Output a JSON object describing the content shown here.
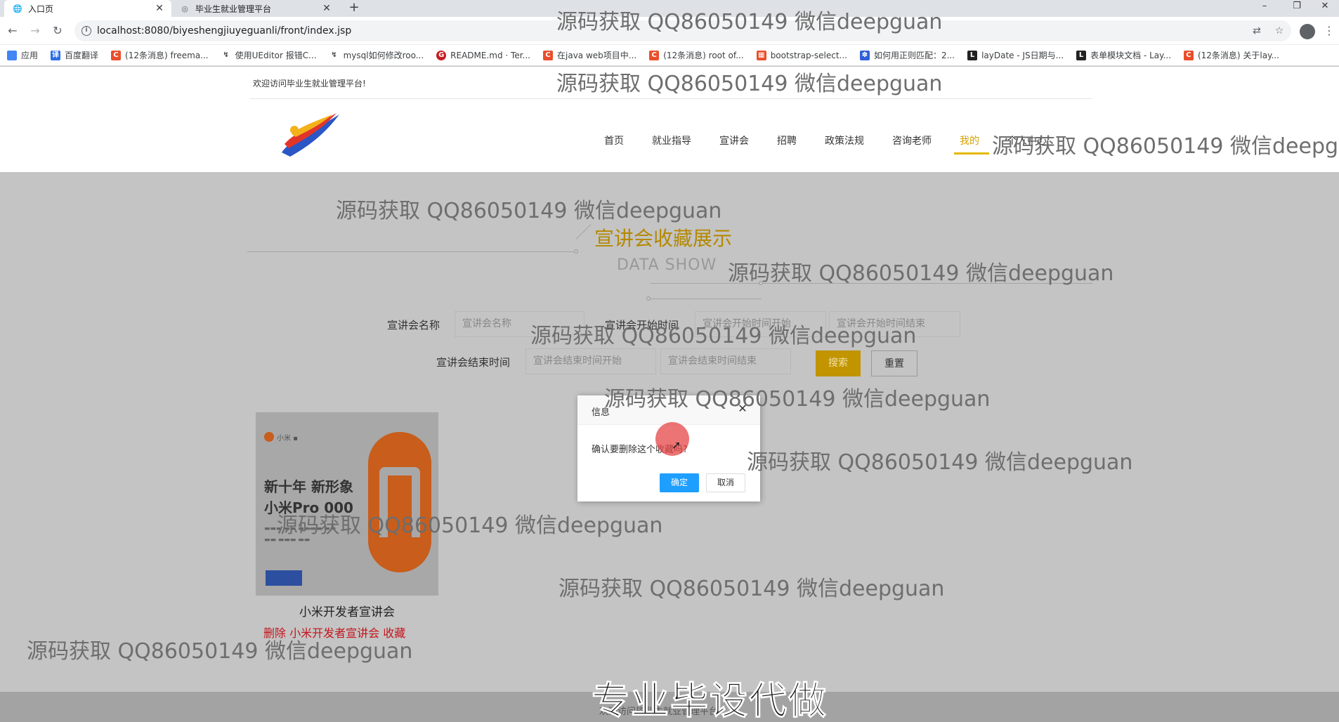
{
  "browser": {
    "tabs": [
      {
        "title": "入口页",
        "active": true
      },
      {
        "title": "毕业生就业管理平台",
        "active": false
      }
    ],
    "new_tab": "+",
    "window_controls": [
      "–",
      "❐",
      "✕"
    ],
    "url": "localhost:8080/biyeshengjiuyeguanli/front/index.jsp",
    "bookmarks": [
      {
        "label": "应用",
        "icon_color": "#4285f4"
      },
      {
        "label": "百度翻译",
        "icon_color": "#2b6de6"
      },
      {
        "label": "(12条消息) freema...",
        "icon_color": "#e94e2b"
      },
      {
        "label": "使用UEditor 报错C...",
        "icon_color": "#444444"
      },
      {
        "label": "mysql如何修改roo...",
        "icon_color": "#444444"
      },
      {
        "label": "README.md · Ter...",
        "icon_color": "#c71d23"
      },
      {
        "label": "在java web项目中...",
        "icon_color": "#e94e2b"
      },
      {
        "label": "(12条消息) root of...",
        "icon_color": "#e94e2b"
      },
      {
        "label": "bootstrap-select...",
        "icon_color": "#e94e2b"
      },
      {
        "label": "如何用正则匹配：2...",
        "icon_color": "#3060d8"
      },
      {
        "label": "layDate - JS日期与...",
        "icon_color": "#222222"
      },
      {
        "label": "表单模块文档 - Lay...",
        "icon_color": "#222222"
      },
      {
        "label": "(12条消息) 关于lay...",
        "icon_color": "#e94e2b"
      }
    ]
  },
  "site": {
    "welcome": "欢迎访问毕业生就业管理平台!",
    "nav": [
      "首页",
      "就业指导",
      "宣讲会",
      "招聘",
      "政策法规",
      "咨询老师",
      "我的",
      "个人中心"
    ],
    "active_nav_index": 6,
    "accent_color": "#e5b800"
  },
  "section": {
    "title": "宣讲会收藏展示",
    "subtitle": "DATA SHOW"
  },
  "search": {
    "name_label": "宣讲会名称",
    "name_placeholder": "宣讲会名称",
    "start_label": "宣讲会开始时间",
    "start_from_placeholder": "宣讲会开始时间开始",
    "start_to_placeholder": "宣讲会开始时间结束",
    "end_label": "宣讲会结束时间",
    "end_from_placeholder": "宣讲会结束时间开始",
    "end_to_placeholder": "宣讲会结束时间结束",
    "search_label": "搜索",
    "reset_label": "重置"
  },
  "card": {
    "image_line1": "新十年 新形象",
    "image_line2": "小米Pro 000",
    "title": "小米开发者宣讲会",
    "delete_label": "删除",
    "name_label": "小米开发者宣讲会",
    "collect_label": "收藏"
  },
  "dialog": {
    "title": "信息",
    "message": "确认要删除这个收藏吗?",
    "ok_label": "确定",
    "cancel_label": "取消",
    "close_icon": "✕"
  },
  "footer": {
    "text": "欢迎访问毕业生就业管理平台"
  },
  "overlay": {
    "watermark": "源码获取 QQ86050149 微信deepguan",
    "caption": "专业毕设代做"
  }
}
